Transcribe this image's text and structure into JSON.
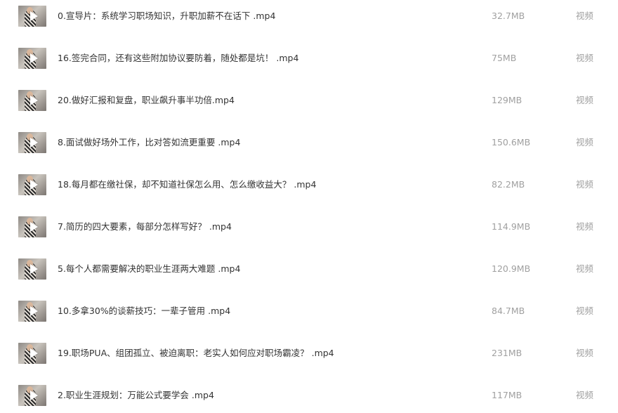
{
  "files": [
    {
      "name": "0.宣导片：系统学习职场知识，升职加薪不在话下 .mp4",
      "size": "32.7MB",
      "type": "视频",
      "thumb_icon": "video-thumbnail-icon"
    },
    {
      "name": "16.签完合同，还有这些附加协议要防着，随处都是坑！ .mp4",
      "size": "75MB",
      "type": "视频",
      "thumb_icon": "video-thumbnail-icon"
    },
    {
      "name": "20.做好汇报和复盘，职业飙升事半功倍.mp4",
      "size": "129MB",
      "type": "视频",
      "thumb_icon": "video-thumbnail-icon"
    },
    {
      "name": "8.面试做好场外工作，比对答如流更重要 .mp4",
      "size": "150.6MB",
      "type": "视频",
      "thumb_icon": "video-thumbnail-icon"
    },
    {
      "name": "18.每月都在缴社保，却不知道社保怎么用、怎么缴收益大？ .mp4",
      "size": "82.2MB",
      "type": "视频",
      "thumb_icon": "video-thumbnail-icon"
    },
    {
      "name": "7.简历的四大要素，每部分怎样写好？ .mp4",
      "size": "114.9MB",
      "type": "视频",
      "thumb_icon": "video-thumbnail-icon"
    },
    {
      "name": "5.每个人都需要解决的职业生涯两大难题 .mp4",
      "size": "120.9MB",
      "type": "视频",
      "thumb_icon": "video-thumbnail-icon"
    },
    {
      "name": "10.多拿30%的谈薪技巧：一辈子管用 .mp4",
      "size": "84.7MB",
      "type": "视频",
      "thumb_icon": "video-thumbnail-icon"
    },
    {
      "name": "19.职场PUA、组团孤立、被迫离职：老实人如何应对职场霸凌？ .mp4",
      "size": "231MB",
      "type": "视频",
      "thumb_icon": "video-thumbnail-icon"
    },
    {
      "name": "2.职业生涯规划：万能公式要学会 .mp4",
      "size": "117MB",
      "type": "视频",
      "thumb_icon": "video-thumbnail-icon"
    }
  ]
}
